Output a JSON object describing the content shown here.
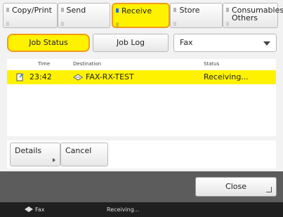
{
  "tabs": [
    {
      "label": "Copy/Print"
    },
    {
      "label": "Send"
    },
    {
      "label": "Receive"
    },
    {
      "label": "Store"
    },
    {
      "label": "Consumables/ Others"
    }
  ],
  "subtabs": {
    "job_status": "Job Status",
    "job_log": "Job Log"
  },
  "filter": {
    "selected": "Fax"
  },
  "list": {
    "columns": {
      "time": "Time",
      "destination": "Destination",
      "status": "Status"
    },
    "rows": [
      {
        "time": "23:42",
        "destination": "FAX-RX-TEST",
        "status": "Receiving..."
      }
    ]
  },
  "buttons": {
    "details": "Details",
    "cancel": "Cancel",
    "close": "Close"
  },
  "statusbar": {
    "fax_label": "Fax",
    "status": "Receiving..."
  },
  "colors": {
    "highlight": "#fff200",
    "accent_border": "#f39b1b"
  }
}
